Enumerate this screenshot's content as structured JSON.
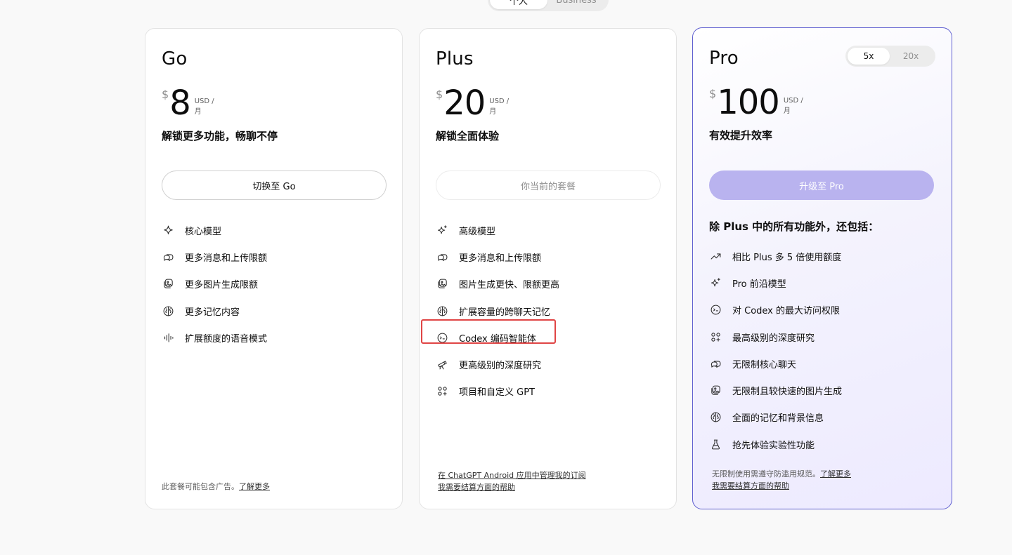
{
  "top_toggle": {
    "personal": "个人",
    "business": "Business"
  },
  "plans": {
    "go": {
      "name": "Go",
      "currency": "$",
      "amount": "8",
      "unit": "USD / 月",
      "tagline": "解锁更多功能，畅聊不停",
      "cta": "切换至 Go",
      "features": [
        {
          "icon": "sparkle-icon",
          "label": "核心模型"
        },
        {
          "icon": "chat-bubbles-icon",
          "label": "更多消息和上传限额"
        },
        {
          "icon": "image-gen-icon",
          "label": "更多图片生成限额"
        },
        {
          "icon": "brain-icon",
          "label": "更多记忆内容"
        },
        {
          "icon": "voice-wave-icon",
          "label": "扩展额度的语音模式"
        }
      ],
      "footnote_text": "此套餐可能包含广告。",
      "footnote_link": "了解更多"
    },
    "plus": {
      "name": "Plus",
      "currency": "$",
      "amount": "20",
      "unit": "USD / 月",
      "tagline": "解锁全面体验",
      "cta": "你当前的套餐",
      "features": [
        {
          "icon": "sparkles-icon",
          "label": "高级模型"
        },
        {
          "icon": "chat-bubbles-icon",
          "label": "更多消息和上传限额"
        },
        {
          "icon": "image-gen-icon",
          "label": "图片生成更快、限额更高"
        },
        {
          "icon": "brain-icon",
          "label": "扩展容量的跨聊天记忆"
        },
        {
          "icon": "codex-icon",
          "label": "Codex 编码智能体"
        },
        {
          "icon": "telescope-icon",
          "label": "更高级别的深度研究"
        },
        {
          "icon": "apps-icon",
          "label": "项目和自定义 GPT"
        }
      ],
      "footnote_link1": "在 ChatGPT Android 应用中管理我的订阅",
      "footnote_link2": "我需要结算方面的帮助"
    },
    "pro": {
      "name": "Pro",
      "toggle": {
        "option_a": "5x",
        "option_b": "20x",
        "selected": "5x"
      },
      "currency": "$",
      "amount": "100",
      "unit": "USD / 月",
      "tagline": "有效提升效率",
      "cta": "升级至 Pro",
      "section_head": "除 Plus 中的所有功能外，还包括：",
      "features": [
        {
          "icon": "trend-up-icon",
          "label": "相比 Plus 多 5 倍使用额度"
        },
        {
          "icon": "sparkles-icon",
          "label": "Pro 前沿模型"
        },
        {
          "icon": "codex-icon",
          "label": "对 Codex 的最大访问权限"
        },
        {
          "icon": "apps-icon",
          "label": "最高级别的深度研究"
        },
        {
          "icon": "chat-bubbles-icon",
          "label": "无限制核心聊天"
        },
        {
          "icon": "image-gen-icon",
          "label": "无限制且较快速的图片生成"
        },
        {
          "icon": "brain-icon",
          "label": "全面的记忆和背景信息"
        },
        {
          "icon": "flask-icon",
          "label": "抢先体验实验性功能"
        }
      ],
      "footnote_text": "无限制使用需遵守防滥用规范。",
      "footnote_link": "了解更多",
      "footnote_link2": "我需要结算方面的帮助"
    }
  }
}
